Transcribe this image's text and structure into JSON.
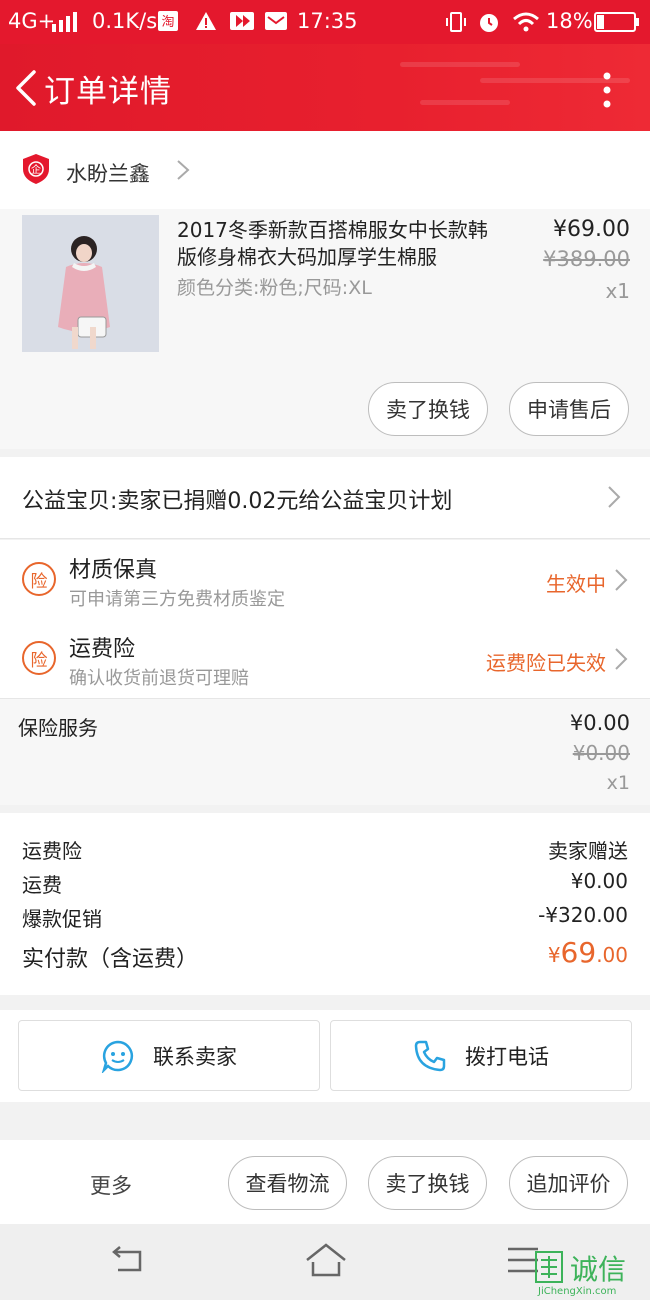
{
  "status_bar": {
    "network": "4G+",
    "speed": "0.1K/s",
    "time": "17:35",
    "battery": "18%"
  },
  "header": {
    "title": "订单详情"
  },
  "shop": {
    "name": "水盼兰鑫"
  },
  "product": {
    "title": "2017冬季新款百搭棉服女中长款韩版修身棉衣大码加厚学生棉服",
    "sku": "颜色分类:粉色;尺码:XL",
    "price": "¥69.00",
    "original_price": "¥389.00",
    "quantity": "x1",
    "buttons": {
      "sell": "卖了换钱",
      "after_sale": "申请售后"
    }
  },
  "charity": {
    "text": "公益宝贝:卖家已捐赠0.02元给公益宝贝计划"
  },
  "insurance": [
    {
      "icon_label": "险",
      "title": "材质保真",
      "subtitle": "可申请第三方免费材质鉴定",
      "status": "生效中"
    },
    {
      "icon_label": "险",
      "title": "运费险",
      "subtitle": "确认收货前退货可理赔",
      "status": "运费险已失效"
    }
  ],
  "insurance_service": {
    "label": "保险服务",
    "price": "¥0.00",
    "original_price": "¥0.00",
    "quantity": "x1"
  },
  "summary": {
    "rows": [
      {
        "label": "运费险",
        "value": "卖家赠送"
      },
      {
        "label": "运费",
        "value": "¥0.00"
      },
      {
        "label": "爆款促销",
        "value": "-¥320.00"
      }
    ],
    "paid_label": "实付款（含运费）",
    "paid_currency": "¥",
    "paid_int": "69",
    "paid_dec": ".00"
  },
  "contact": {
    "seller": "联系卖家",
    "phone": "拨打电话"
  },
  "actions": {
    "more": "更多",
    "logistics": "查看物流",
    "sell": "卖了换钱",
    "review": "追加评价"
  },
  "watermark": {
    "cn": "诚信",
    "en": "JiChengXin.com"
  },
  "colors": {
    "brand_red": "#e4182d",
    "accent_orange": "#e8662c",
    "chat_blue": "#29a3e0"
  }
}
